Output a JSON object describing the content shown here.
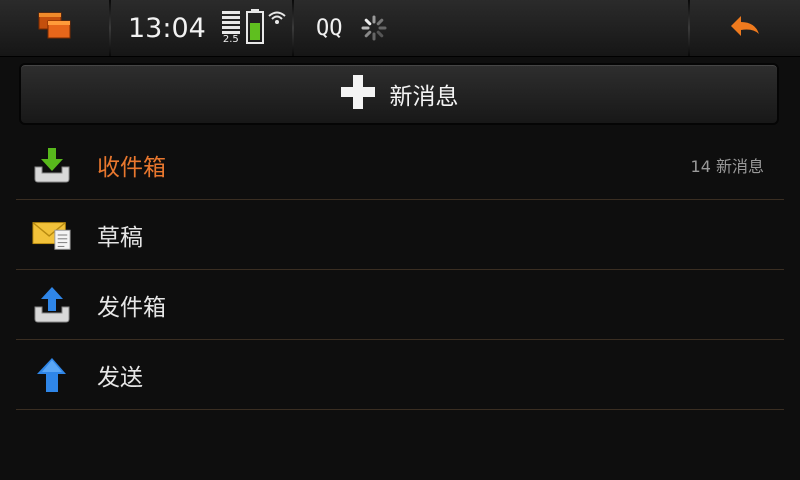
{
  "statusbar": {
    "clock": "13:04",
    "network": "2.5",
    "account": "QQ",
    "task_switcher_icon": "task-switcher-icon",
    "back_icon": "back-arrow-icon"
  },
  "new_message_button": {
    "label": "新消息",
    "icon": "plus-icon"
  },
  "folders": [
    {
      "label": "收件箱",
      "icon": "inbox-icon",
      "count": "14 新消息",
      "active": true
    },
    {
      "label": "草稿",
      "icon": "drafts-icon",
      "count": "",
      "active": false
    },
    {
      "label": "发件箱",
      "icon": "outbox-icon",
      "count": "",
      "active": false
    },
    {
      "label": "发送",
      "icon": "sent-icon",
      "count": "",
      "active": false
    }
  ],
  "colors": {
    "accent": "#e8772e",
    "background": "#0e0e0e",
    "divider": "#3a2e22"
  }
}
